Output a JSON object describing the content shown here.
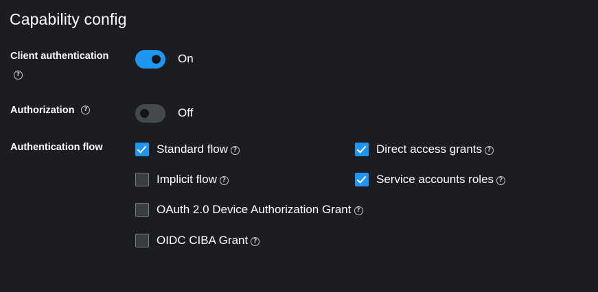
{
  "title": "Capability config",
  "client_authentication": {
    "label": "Client authentication",
    "state_label": "On",
    "enabled": true
  },
  "authorization": {
    "label": "Authorization",
    "state_label": "Off",
    "enabled": false
  },
  "authentication_flow": {
    "label": "Authentication flow",
    "options": [
      {
        "label": "Standard flow",
        "checked": true
      },
      {
        "label": "Direct access grants",
        "checked": true
      },
      {
        "label": "Implicit flow",
        "checked": false
      },
      {
        "label": "Service accounts roles",
        "checked": true
      },
      {
        "label": "OAuth 2.0 Device Authorization Grant",
        "checked": false
      },
      {
        "label": "OIDC CIBA Grant",
        "checked": false
      }
    ]
  },
  "help_icon_glyph": "?",
  "colors": {
    "background": "#1b1d21",
    "accent": "#1f96f3",
    "toggle_off": "#45484d"
  }
}
